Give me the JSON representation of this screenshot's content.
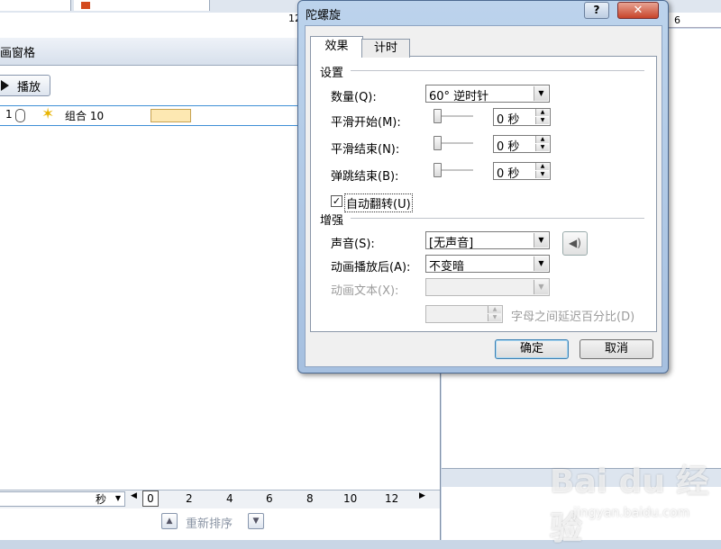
{
  "task_pane": {
    "title": "画窗格",
    "play_label": "播放",
    "row": {
      "num": "1",
      "name": "组合 10"
    },
    "timeline": {
      "unit": "秒",
      "ticks": [
        "0",
        "2",
        "4",
        "6",
        "8",
        "10",
        "12"
      ]
    },
    "reorder_label": "重新排序"
  },
  "ruler": {
    "left": "12",
    "right": "6"
  },
  "dialog": {
    "title": "陀螺旋",
    "help": "?",
    "close": "✕",
    "tabs": [
      "效果",
      "计时"
    ],
    "settings": {
      "heading": "设置",
      "amount_label": "数量(Q):",
      "amount_value": "60°   逆时针",
      "smooth_start_label": "平滑开始(M):",
      "smooth_start_value": "0 秒",
      "smooth_end_label": "平滑结束(N):",
      "smooth_end_value": "0 秒",
      "bounce_end_label": "弹跳结束(B):",
      "bounce_end_value": "0 秒",
      "auto_reverse_label": "自动翻转(U)",
      "auto_reverse_checked": true
    },
    "enhance": {
      "heading": "增强",
      "sound_label": "声音(S):",
      "sound_value": "[无声音]",
      "after_label": "动画播放后(A):",
      "after_value": "不变暗",
      "text_label": "动画文本(X):",
      "delay_label": "字母之间延迟百分比(D)"
    },
    "ok_label": "确定",
    "cancel_label": "取消"
  },
  "watermark": {
    "brand": "Bai du 经验",
    "url": "jingyan.baidu.com"
  }
}
